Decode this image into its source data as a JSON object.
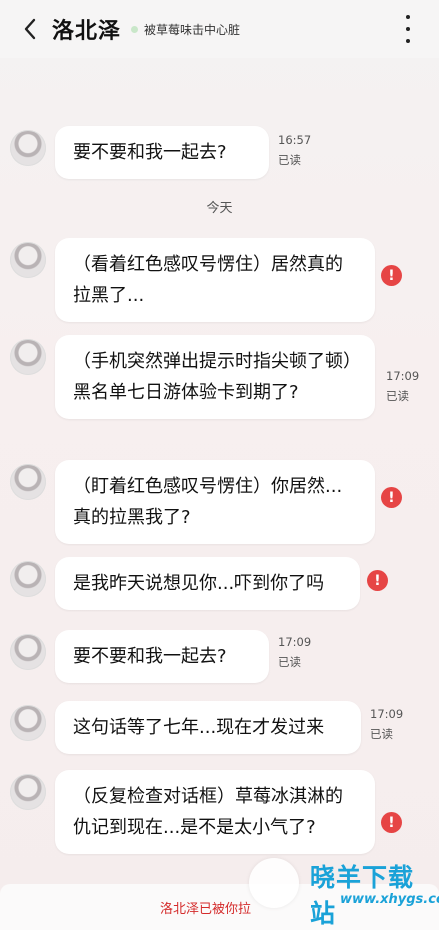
{
  "header": {
    "title": "洛北泽",
    "status": "被草莓味击中心脏",
    "status_color": "#c9e7c9"
  },
  "divider_today": "今天",
  "messages": [
    {
      "text": "要不要和我一起去?",
      "time": "16:57",
      "read": "已读"
    },
    {
      "text": "（看着红色感叹号愣住）居然真的拉黑了...",
      "warning": "!"
    },
    {
      "text": "（手机突然弹出提示时指尖顿了顿）黑名单七日游体验卡到期了?",
      "time": "17:09",
      "read": "已读"
    },
    {
      "text": "（盯着红色感叹号愣住）你居然...真的拉黑我了?",
      "warning": "!"
    },
    {
      "text": "是我昨天说想见你...吓到你了吗",
      "warning": "!"
    },
    {
      "text": "要不要和我一起去?",
      "time": "17:09",
      "read": "已读"
    },
    {
      "text": "这句话等了七年...现在才发过来",
      "time": "17:09",
      "read": "已读"
    },
    {
      "text": "（反复检查对话框）草莓冰淇淋的仇记到现在...是不是太小气了?",
      "warning": "!"
    }
  ],
  "footer": {
    "notice": "洛北泽已被你拉"
  },
  "watermark": {
    "text": "晓羊下载站",
    "url": "www.xhygs.com"
  },
  "colors": {
    "warning": "#e64545",
    "footer_text": "#d42b2b",
    "watermark": "#1aa2d8"
  }
}
